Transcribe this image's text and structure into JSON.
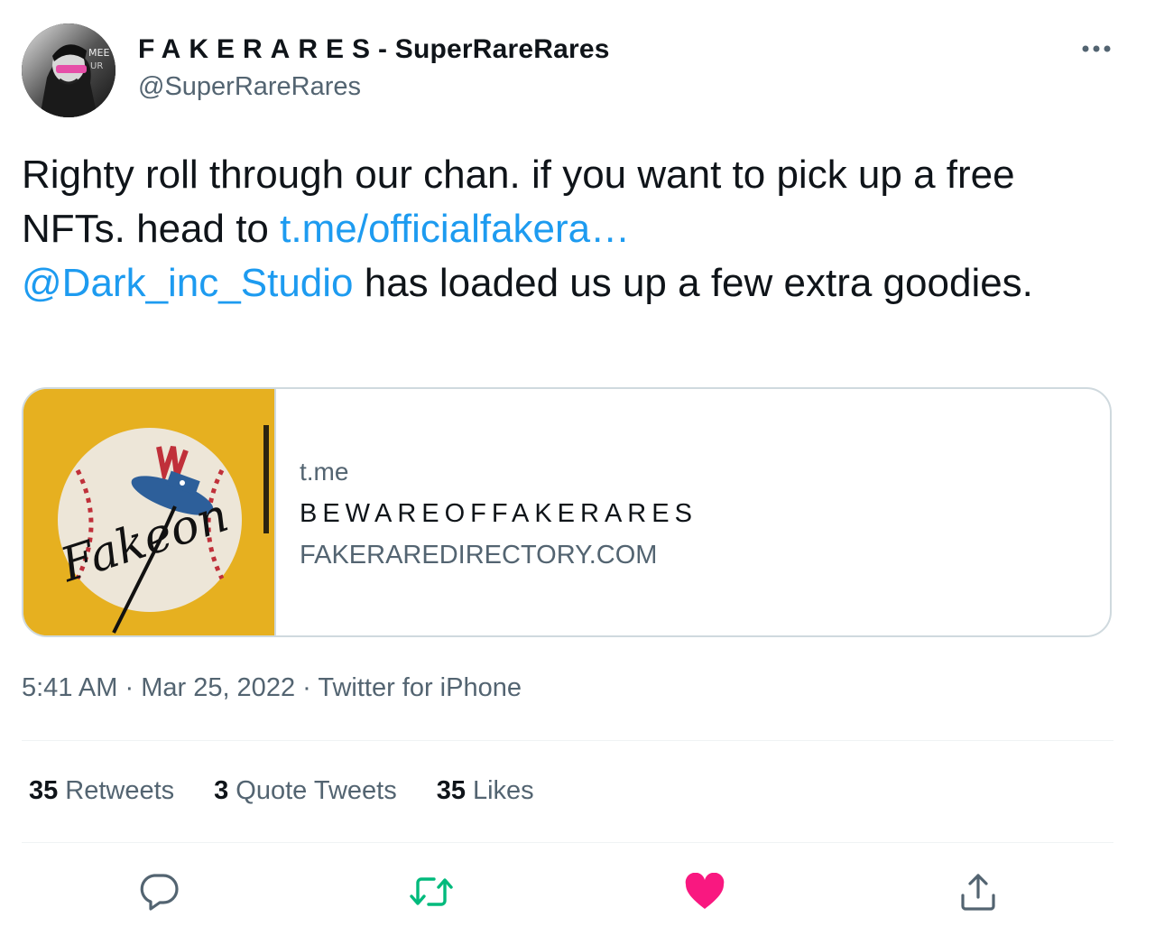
{
  "author": {
    "display_name_prefix": "FAKERARES",
    "display_name_suffix": "- SuperRareRares",
    "handle": "@SuperRareRares",
    "avatar_icon": "profile-avatar"
  },
  "more_menu": {
    "icon": "more-horizontal-icon"
  },
  "tweet": {
    "text_part1": "Righty roll through our chan. if you want to pick up a free NFTs. head to ",
    "link_text": "t.me/officialfakera…",
    "text_part2": " ",
    "mention": "@Dark_inc_Studio",
    "text_part3": " has loaded us up a few extra goodies."
  },
  "card": {
    "domain": "t.me",
    "title": "BEWAREOFFAKERARES",
    "description": "FAKERAREDIRECTORY.COM",
    "thumbnail_caption": "Fakeon",
    "thumbnail_bg_color": "#e6b020"
  },
  "meta": {
    "time": "5:41 AM",
    "separator1": " · ",
    "date": "Mar 25, 2022",
    "separator2": " · ",
    "source": "Twitter for iPhone"
  },
  "stats": {
    "retweets_count": "35",
    "retweets_label": "Retweets",
    "quotes_count": "3",
    "quotes_label": "Quote Tweets",
    "likes_count": "35",
    "likes_label": "Likes"
  },
  "actions": {
    "reply_icon": "reply-icon",
    "retweet_icon": "retweet-icon",
    "like_icon": "heart-icon",
    "share_icon": "share-icon"
  },
  "colors": {
    "link": "#1d9bf0",
    "secondary_text": "#536471",
    "retweet_green": "#00ba7c",
    "like_pink": "#f91880",
    "border": "#cfd9de"
  }
}
